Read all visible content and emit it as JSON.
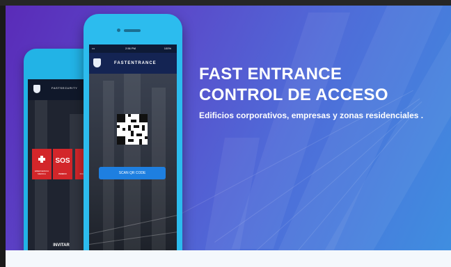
{
  "hero": {
    "title_line1": "FAST ENTRANCE",
    "title_line2": "CONTROL DE ACCESO",
    "subtitle": "Edificios corporativos, empresas y zonas residenciales ."
  },
  "phone_back": {
    "app_title": "FASTSECURITY",
    "tile_sos": "SOS",
    "tile_left_label": "EMERGENCIA MEDICA",
    "tile_sos_label": "PANICO",
    "tile_right_label": "INCENDIO",
    "invite_label": "INVITAR"
  },
  "phone_front": {
    "status_time": "2:56 PM",
    "status_battery": "100%",
    "status_carrier": "•••",
    "app_title": "FASTENTRANCE",
    "scan_button": "SCAN QR CODE"
  },
  "colors": {
    "hero_gradient_start": "#5a2bb8",
    "hero_gradient_end": "#3f8ee0",
    "phone_body": "#2cbcee",
    "scan_button": "#1e7fe0",
    "alert_tile": "#d3262a"
  }
}
